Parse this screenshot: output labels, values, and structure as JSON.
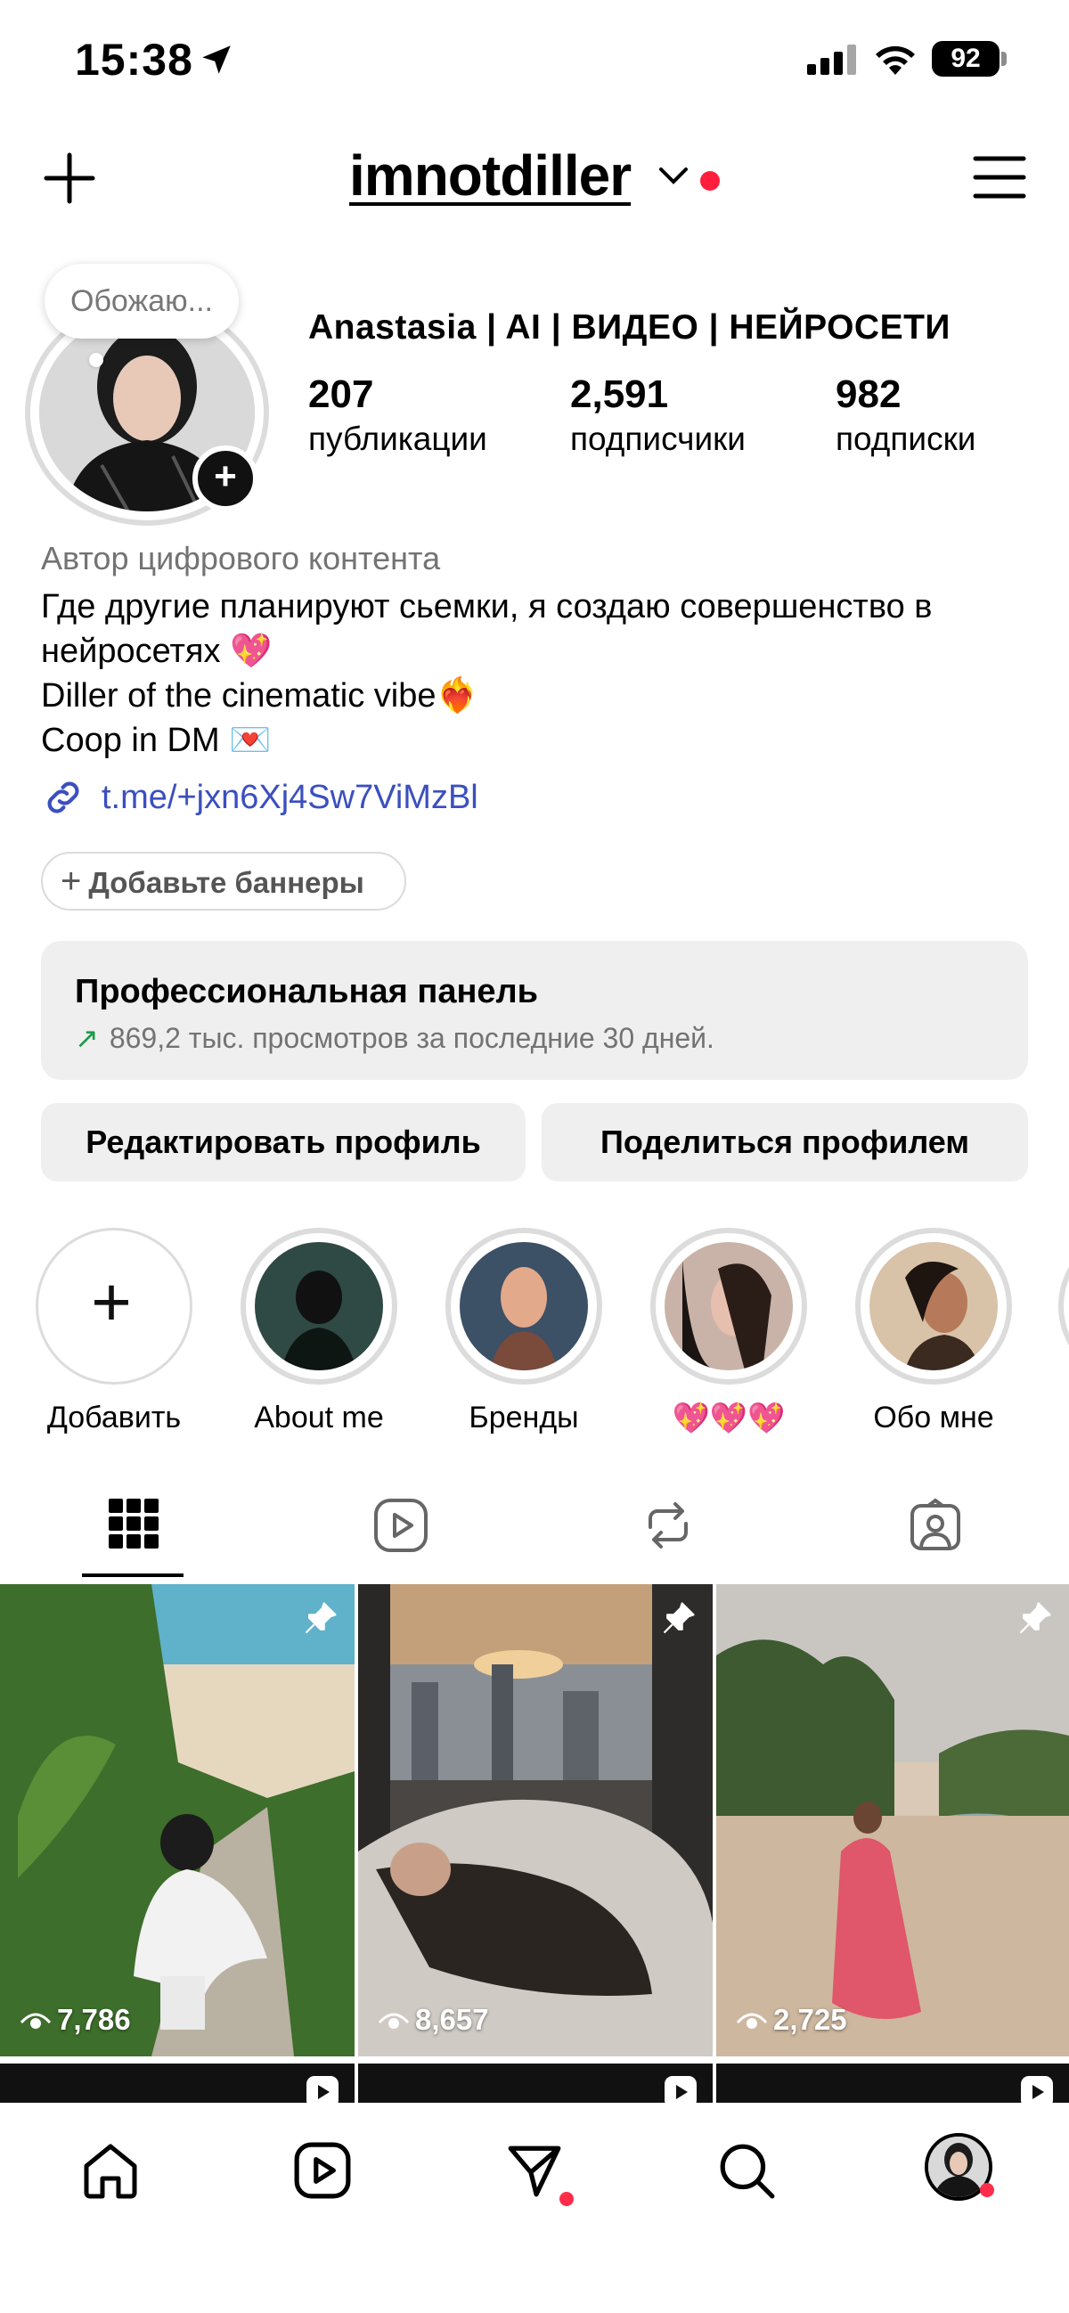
{
  "status_bar": {
    "time": "15:38",
    "battery": "92"
  },
  "header": {
    "username": "imnotdiller",
    "live_dot_color": "#ff1f3d"
  },
  "profile": {
    "note": "Обожаю...",
    "display_name": "Anastasia | AI | ВИДЕО | НЕЙРОСЕТИ",
    "stats": [
      {
        "number": "207",
        "label": "публикации"
      },
      {
        "number": "2,591",
        "label": "подписчики"
      },
      {
        "number": "982",
        "label": "подписки"
      }
    ],
    "category": "Автор цифрового контента",
    "bio_lines": [
      "Где другие планируют сьемки, я создаю совершенство в",
      "нейросетях 💖",
      "Diller of the cinematic vibe❤️‍🔥",
      "Coop in DM 💌"
    ],
    "link": "t.me/+jxn6Xj4Sw7ViMzBl",
    "banner_button": "Добавьте баннеры"
  },
  "pro_panel": {
    "title": "Профессиональная панель",
    "subtitle": "869,2 тыс. просмотров за последние 30 дней."
  },
  "actions": {
    "edit": "Редактировать профиль",
    "share": "Поделиться профилем"
  },
  "highlights": [
    {
      "label": "Добавить"
    },
    {
      "label": "About me"
    },
    {
      "label": "Бренды"
    },
    {
      "label": "💖💖💖"
    },
    {
      "label": "Обо мне"
    }
  ],
  "posts": [
    {
      "views": "7,786"
    },
    {
      "views": "8,657"
    },
    {
      "views": "2,725"
    }
  ],
  "colors": {
    "link": "#3b4fbf",
    "secondary_text": "#737373",
    "panel_bg": "#efefef",
    "notification_dot": "#ff2d4a",
    "growth_arrow": "#1a9b4b"
  },
  "icons": [
    "location-arrow-icon",
    "signal-icon",
    "wifi-icon",
    "plus-icon",
    "chevron-down-icon",
    "menu-icon",
    "link-icon",
    "grid-icon",
    "reels-icon",
    "reposts-icon",
    "tagged-icon",
    "pin-icon",
    "eye-icon",
    "home-icon",
    "direct-icon",
    "search-icon"
  ]
}
